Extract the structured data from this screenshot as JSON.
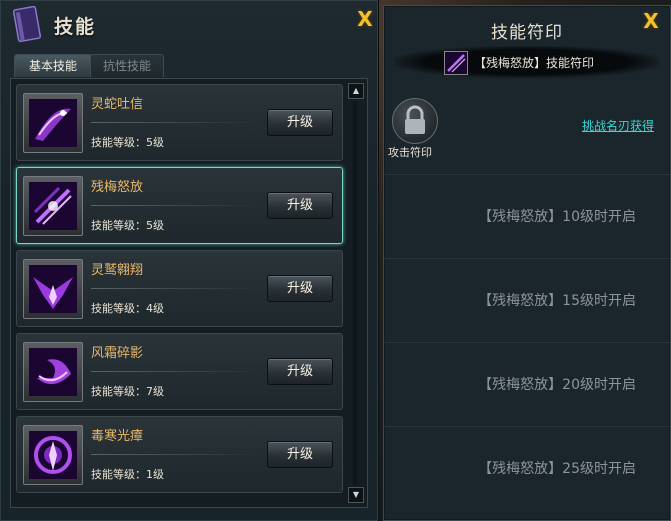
{
  "left_panel": {
    "title": "技能",
    "tabs": [
      {
        "label": "基本技能",
        "active": true
      },
      {
        "label": "抗性技能",
        "active": false
      }
    ],
    "upgrade_label": "升级",
    "level_label_prefix": "技能等级：",
    "skills": [
      {
        "name": "灵蛇吐信",
        "level_text": "技能等级：5级",
        "icon": "serpent-slash-icon",
        "selected": false
      },
      {
        "name": "残梅怒放",
        "level_text": "技能等级：5级",
        "icon": "plum-burst-icon",
        "selected": true
      },
      {
        "name": "灵鹫翱翔",
        "level_text": "技能等级：4级",
        "icon": "eagle-soar-icon",
        "selected": false
      },
      {
        "name": "风霜碎影",
        "level_text": "技能等级：7级",
        "icon": "frost-shadow-icon",
        "selected": false
      },
      {
        "name": "毒寒光瘴",
        "level_text": "技能等级：1级",
        "icon": "poison-aura-icon",
        "selected": false
      }
    ]
  },
  "right_panel": {
    "title": "技能符印",
    "sigil_title": "【残梅怒放】技能符印",
    "attack_slot_label": "攻击符印",
    "obtain_link": "挑战名刃获得",
    "locked_slots": [
      {
        "text": "【残梅怒放】10级时开启"
      },
      {
        "text": "【残梅怒放】15级时开启"
      },
      {
        "text": "【残梅怒放】20级时开启"
      },
      {
        "text": "【残梅怒放】25级时开启"
      }
    ]
  },
  "close_symbol": "X",
  "colors": {
    "accent_gold": "#f2c22a",
    "skill_name": "#e9b86a",
    "selected_border": "#7fd6c8",
    "link": "#3ad6d6",
    "skill_icon_purple": "#a040e0"
  }
}
